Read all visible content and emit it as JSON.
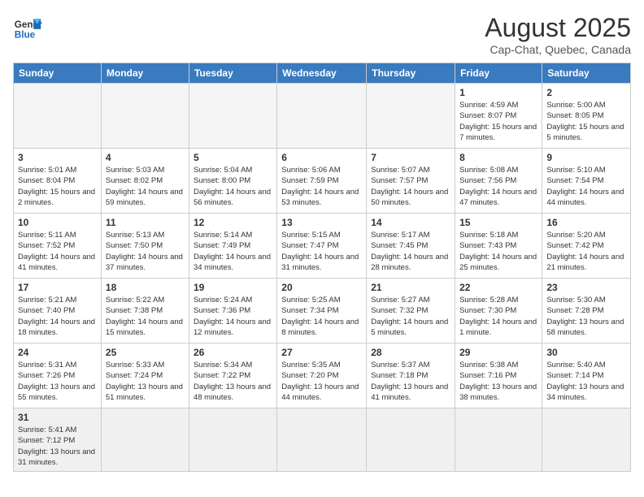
{
  "header": {
    "logo_general": "General",
    "logo_blue": "Blue",
    "title": "August 2025",
    "subtitle": "Cap-Chat, Quebec, Canada"
  },
  "weekdays": [
    "Sunday",
    "Monday",
    "Tuesday",
    "Wednesday",
    "Thursday",
    "Friday",
    "Saturday"
  ],
  "weeks": [
    [
      {
        "num": "",
        "info": ""
      },
      {
        "num": "",
        "info": ""
      },
      {
        "num": "",
        "info": ""
      },
      {
        "num": "",
        "info": ""
      },
      {
        "num": "",
        "info": ""
      },
      {
        "num": "1",
        "info": "Sunrise: 4:59 AM\nSunset: 8:07 PM\nDaylight: 15 hours\nand 7 minutes."
      },
      {
        "num": "2",
        "info": "Sunrise: 5:00 AM\nSunset: 8:05 PM\nDaylight: 15 hours\nand 5 minutes."
      }
    ],
    [
      {
        "num": "3",
        "info": "Sunrise: 5:01 AM\nSunset: 8:04 PM\nDaylight: 15 hours\nand 2 minutes."
      },
      {
        "num": "4",
        "info": "Sunrise: 5:03 AM\nSunset: 8:02 PM\nDaylight: 14 hours\nand 59 minutes."
      },
      {
        "num": "5",
        "info": "Sunrise: 5:04 AM\nSunset: 8:00 PM\nDaylight: 14 hours\nand 56 minutes."
      },
      {
        "num": "6",
        "info": "Sunrise: 5:06 AM\nSunset: 7:59 PM\nDaylight: 14 hours\nand 53 minutes."
      },
      {
        "num": "7",
        "info": "Sunrise: 5:07 AM\nSunset: 7:57 PM\nDaylight: 14 hours\nand 50 minutes."
      },
      {
        "num": "8",
        "info": "Sunrise: 5:08 AM\nSunset: 7:56 PM\nDaylight: 14 hours\nand 47 minutes."
      },
      {
        "num": "9",
        "info": "Sunrise: 5:10 AM\nSunset: 7:54 PM\nDaylight: 14 hours\nand 44 minutes."
      }
    ],
    [
      {
        "num": "10",
        "info": "Sunrise: 5:11 AM\nSunset: 7:52 PM\nDaylight: 14 hours\nand 41 minutes."
      },
      {
        "num": "11",
        "info": "Sunrise: 5:13 AM\nSunset: 7:50 PM\nDaylight: 14 hours\nand 37 minutes."
      },
      {
        "num": "12",
        "info": "Sunrise: 5:14 AM\nSunset: 7:49 PM\nDaylight: 14 hours\nand 34 minutes."
      },
      {
        "num": "13",
        "info": "Sunrise: 5:15 AM\nSunset: 7:47 PM\nDaylight: 14 hours\nand 31 minutes."
      },
      {
        "num": "14",
        "info": "Sunrise: 5:17 AM\nSunset: 7:45 PM\nDaylight: 14 hours\nand 28 minutes."
      },
      {
        "num": "15",
        "info": "Sunrise: 5:18 AM\nSunset: 7:43 PM\nDaylight: 14 hours\nand 25 minutes."
      },
      {
        "num": "16",
        "info": "Sunrise: 5:20 AM\nSunset: 7:42 PM\nDaylight: 14 hours\nand 21 minutes."
      }
    ],
    [
      {
        "num": "17",
        "info": "Sunrise: 5:21 AM\nSunset: 7:40 PM\nDaylight: 14 hours\nand 18 minutes."
      },
      {
        "num": "18",
        "info": "Sunrise: 5:22 AM\nSunset: 7:38 PM\nDaylight: 14 hours\nand 15 minutes."
      },
      {
        "num": "19",
        "info": "Sunrise: 5:24 AM\nSunset: 7:36 PM\nDaylight: 14 hours\nand 12 minutes."
      },
      {
        "num": "20",
        "info": "Sunrise: 5:25 AM\nSunset: 7:34 PM\nDaylight: 14 hours\nand 8 minutes."
      },
      {
        "num": "21",
        "info": "Sunrise: 5:27 AM\nSunset: 7:32 PM\nDaylight: 14 hours\nand 5 minutes."
      },
      {
        "num": "22",
        "info": "Sunrise: 5:28 AM\nSunset: 7:30 PM\nDaylight: 14 hours\nand 1 minute."
      },
      {
        "num": "23",
        "info": "Sunrise: 5:30 AM\nSunset: 7:28 PM\nDaylight: 13 hours\nand 58 minutes."
      }
    ],
    [
      {
        "num": "24",
        "info": "Sunrise: 5:31 AM\nSunset: 7:26 PM\nDaylight: 13 hours\nand 55 minutes."
      },
      {
        "num": "25",
        "info": "Sunrise: 5:33 AM\nSunset: 7:24 PM\nDaylight: 13 hours\nand 51 minutes."
      },
      {
        "num": "26",
        "info": "Sunrise: 5:34 AM\nSunset: 7:22 PM\nDaylight: 13 hours\nand 48 minutes."
      },
      {
        "num": "27",
        "info": "Sunrise: 5:35 AM\nSunset: 7:20 PM\nDaylight: 13 hours\nand 44 minutes."
      },
      {
        "num": "28",
        "info": "Sunrise: 5:37 AM\nSunset: 7:18 PM\nDaylight: 13 hours\nand 41 minutes."
      },
      {
        "num": "29",
        "info": "Sunrise: 5:38 AM\nSunset: 7:16 PM\nDaylight: 13 hours\nand 38 minutes."
      },
      {
        "num": "30",
        "info": "Sunrise: 5:40 AM\nSunset: 7:14 PM\nDaylight: 13 hours\nand 34 minutes."
      }
    ],
    [
      {
        "num": "31",
        "info": "Sunrise: 5:41 AM\nSunset: 7:12 PM\nDaylight: 13 hours\nand 31 minutes."
      },
      {
        "num": "",
        "info": ""
      },
      {
        "num": "",
        "info": ""
      },
      {
        "num": "",
        "info": ""
      },
      {
        "num": "",
        "info": ""
      },
      {
        "num": "",
        "info": ""
      },
      {
        "num": "",
        "info": ""
      }
    ]
  ]
}
